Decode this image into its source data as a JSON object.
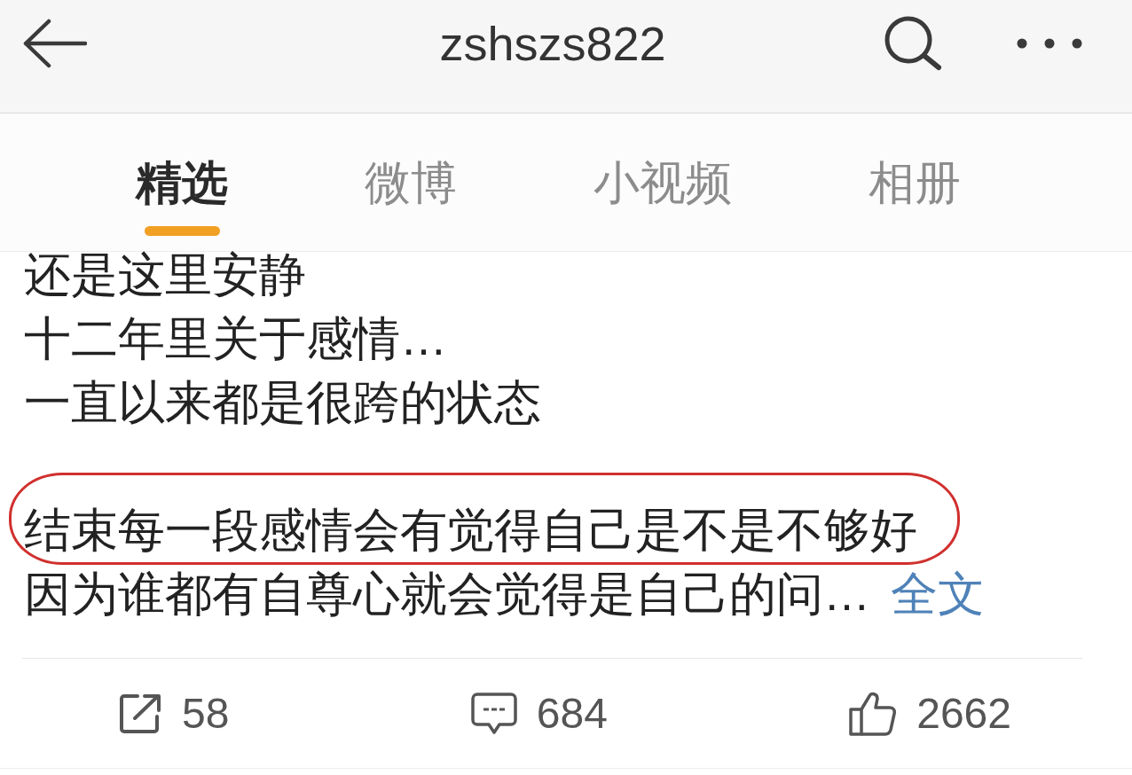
{
  "header": {
    "title": "zshszs822"
  },
  "tabs": [
    {
      "label": "精选",
      "selected": true
    },
    {
      "label": "微博",
      "selected": false
    },
    {
      "label": "小视频",
      "selected": false
    },
    {
      "label": "相册",
      "selected": false
    }
  ],
  "post": {
    "paragraphs": [
      {
        "lines": [
          {
            "text": "还是这里安静",
            "circled": false
          },
          {
            "text": "十二年里关于感情…",
            "circled": false
          },
          {
            "text": "一直以来都是很跨的状态",
            "circled": false
          }
        ]
      },
      {
        "lines": [
          {
            "text": "结束每一段感情会有觉得自己是不是不够好",
            "circled": true
          },
          {
            "text": "因为谁都有自尊心就会觉得是自己的问…",
            "circled": false
          }
        ]
      }
    ],
    "more_link": "全文"
  },
  "actions": [
    {
      "kind": "share",
      "count": "58"
    },
    {
      "kind": "comment",
      "count": "684"
    },
    {
      "kind": "like",
      "count": "2662"
    }
  ]
}
